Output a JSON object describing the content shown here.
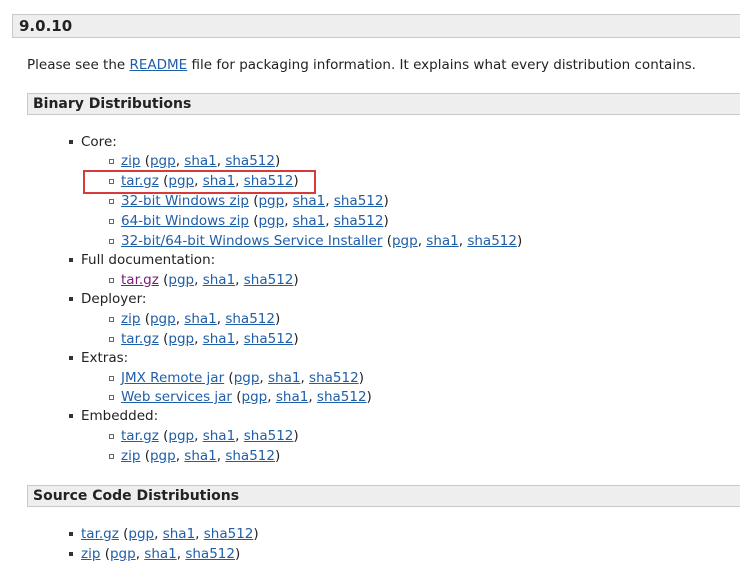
{
  "version_title": "9.0.10",
  "intro": {
    "before": "Please see the ",
    "link": "README",
    "after": " file for packaging information. It explains what every distribution contains."
  },
  "binary": {
    "title": "Binary Distributions",
    "groups": [
      {
        "label": "Core:",
        "items": [
          {
            "main": "zip",
            "sigs": [
              "pgp",
              "sha1",
              "sha512"
            ]
          },
          {
            "main": "tar.gz",
            "sigs": [
              "pgp",
              "sha1",
              "sha512"
            ]
          },
          {
            "main": "32-bit Windows zip",
            "sigs": [
              "pgp",
              "sha1",
              "sha512"
            ]
          },
          {
            "main": "64-bit Windows zip",
            "sigs": [
              "pgp",
              "sha1",
              "sha512"
            ]
          },
          {
            "main": "32-bit/64-bit Windows Service Installer",
            "sigs": [
              "pgp",
              "sha1",
              "sha512"
            ]
          }
        ]
      },
      {
        "label": "Full documentation:",
        "items": [
          {
            "main": "tar.gz",
            "sigs": [
              "pgp",
              "sha1",
              "sha512"
            ]
          }
        ]
      },
      {
        "label": "Deployer:",
        "items": [
          {
            "main": "zip",
            "sigs": [
              "pgp",
              "sha1",
              "sha512"
            ]
          },
          {
            "main": "tar.gz",
            "sigs": [
              "pgp",
              "sha1",
              "sha512"
            ]
          }
        ]
      },
      {
        "label": "Extras:",
        "items": [
          {
            "main": "JMX Remote jar",
            "sigs": [
              "pgp",
              "sha1",
              "sha512"
            ]
          },
          {
            "main": "Web services jar",
            "sigs": [
              "pgp",
              "sha1",
              "sha512"
            ]
          }
        ]
      },
      {
        "label": "Embedded:",
        "items": [
          {
            "main": "tar.gz",
            "sigs": [
              "pgp",
              "sha1",
              "sha512"
            ]
          },
          {
            "main": "zip",
            "sigs": [
              "pgp",
              "sha1",
              "sha512"
            ]
          }
        ]
      }
    ]
  },
  "source": {
    "title": "Source Code Distributions",
    "items": [
      {
        "main": "tar.gz",
        "sigs": [
          "pgp",
          "sha1",
          "sha512"
        ]
      },
      {
        "main": "zip",
        "sigs": [
          "pgp",
          "sha1",
          "sha512"
        ]
      }
    ]
  },
  "colors": {
    "link": "#1f5ea8",
    "visited_link": "#7a1c74",
    "highlight": "#d63a3a"
  }
}
